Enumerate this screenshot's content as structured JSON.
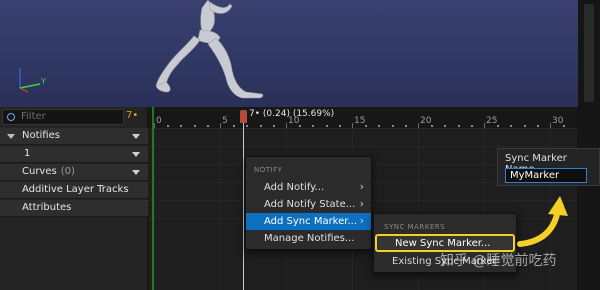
{
  "viewport": {
    "axis_label": "Y",
    "accent_axis_x": "#d23030",
    "accent_axis_y": "#3fd23f",
    "accent_axis_z": "#3060d2",
    "icons": [
      "character-mesh",
      "axis-gizmo-icon"
    ]
  },
  "left_panel": {
    "filter_placeholder": "Filter",
    "filter_count": "7•",
    "notifies_label": "Notifies",
    "track1_label": "1",
    "curves_label": "Curves",
    "curves_count": "(0)",
    "additive_label": "Additive Layer Tracks",
    "attributes_label": "Attributes"
  },
  "timeline": {
    "time_readout": "7• (0.24) (15.69%)",
    "tick_labels": [
      "0",
      "5",
      "10",
      "15",
      "20",
      "25",
      "30"
    ],
    "playhead_color": "#b34a3c",
    "range_start_color": "#1f7a1f"
  },
  "context_menu": {
    "heading": "NOTIFY",
    "items": [
      {
        "label": "Add Notify...",
        "has_submenu": true
      },
      {
        "label": "Add Notify State...",
        "has_submenu": true
      },
      {
        "label": "Add Sync Marker...",
        "has_submenu": true,
        "active": true
      },
      {
        "label": "Manage Notifies...",
        "has_submenu": false
      }
    ],
    "active_color": "#0e70c0"
  },
  "submenu": {
    "heading": "SYNC MARKERS",
    "items": [
      {
        "label": "New Sync Marker...",
        "highlighted": true
      },
      {
        "label": "Existing Sync Marker"
      }
    ],
    "highlight_color": "#f4cf25"
  },
  "name_popup": {
    "title": "Sync Marker Name",
    "value": "MyMarker"
  },
  "watermark": {
    "text": "知乎 @睡觉前吃药"
  }
}
